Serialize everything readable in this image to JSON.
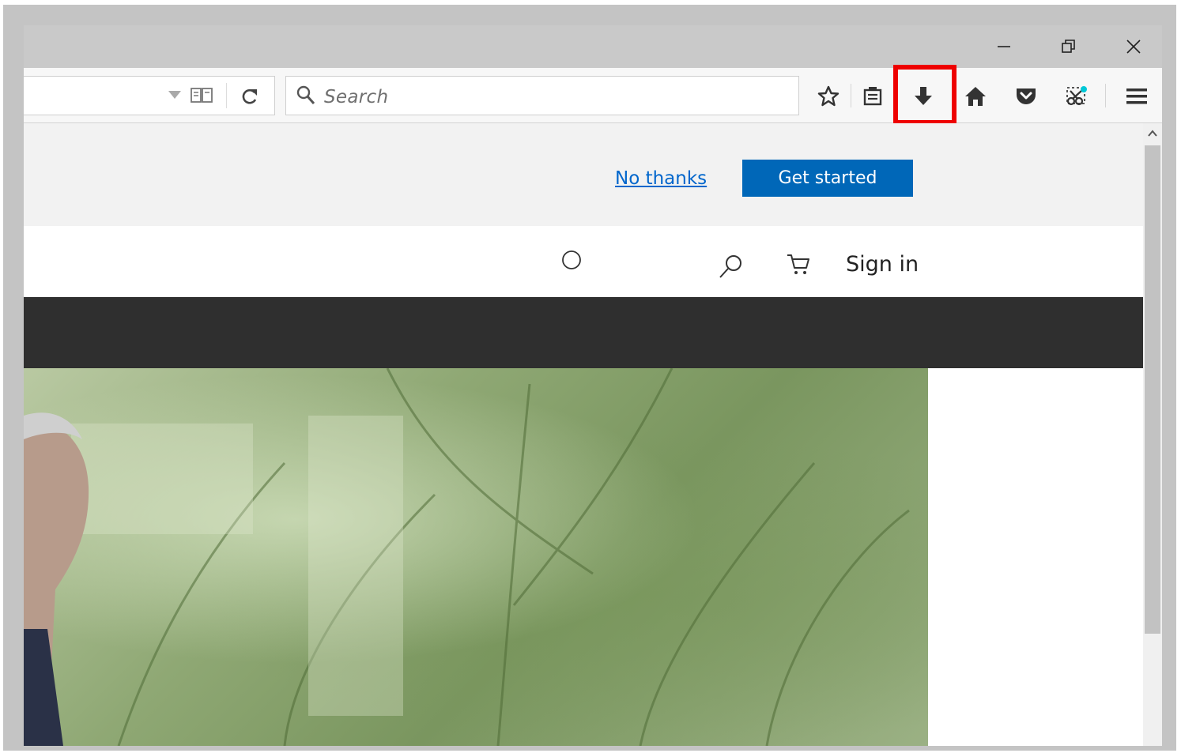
{
  "window": {
    "minimize_icon": "minimize-icon",
    "restore_icon": "restore-icon",
    "close_icon": "close-icon"
  },
  "toolbar": {
    "search_placeholder": "Search",
    "icons": [
      "dropdown-arrow-icon",
      "reader-view-icon",
      "reload-icon",
      "search-icon",
      "bookmark-star-icon",
      "library-icon",
      "download-icon",
      "home-icon",
      "pocket-icon",
      "screenshot-icon",
      "menu-icon"
    ],
    "highlight_color": "#ee0000"
  },
  "notice": {
    "no_thanks": "No thanks",
    "get_started": "Get started",
    "button_color": "#0067b8"
  },
  "site_header": {
    "sign_in": "Sign in",
    "icons": [
      "circle-icon",
      "search-icon",
      "cart-icon"
    ]
  },
  "colors": {
    "dark_bar": "#2f2f2f"
  }
}
